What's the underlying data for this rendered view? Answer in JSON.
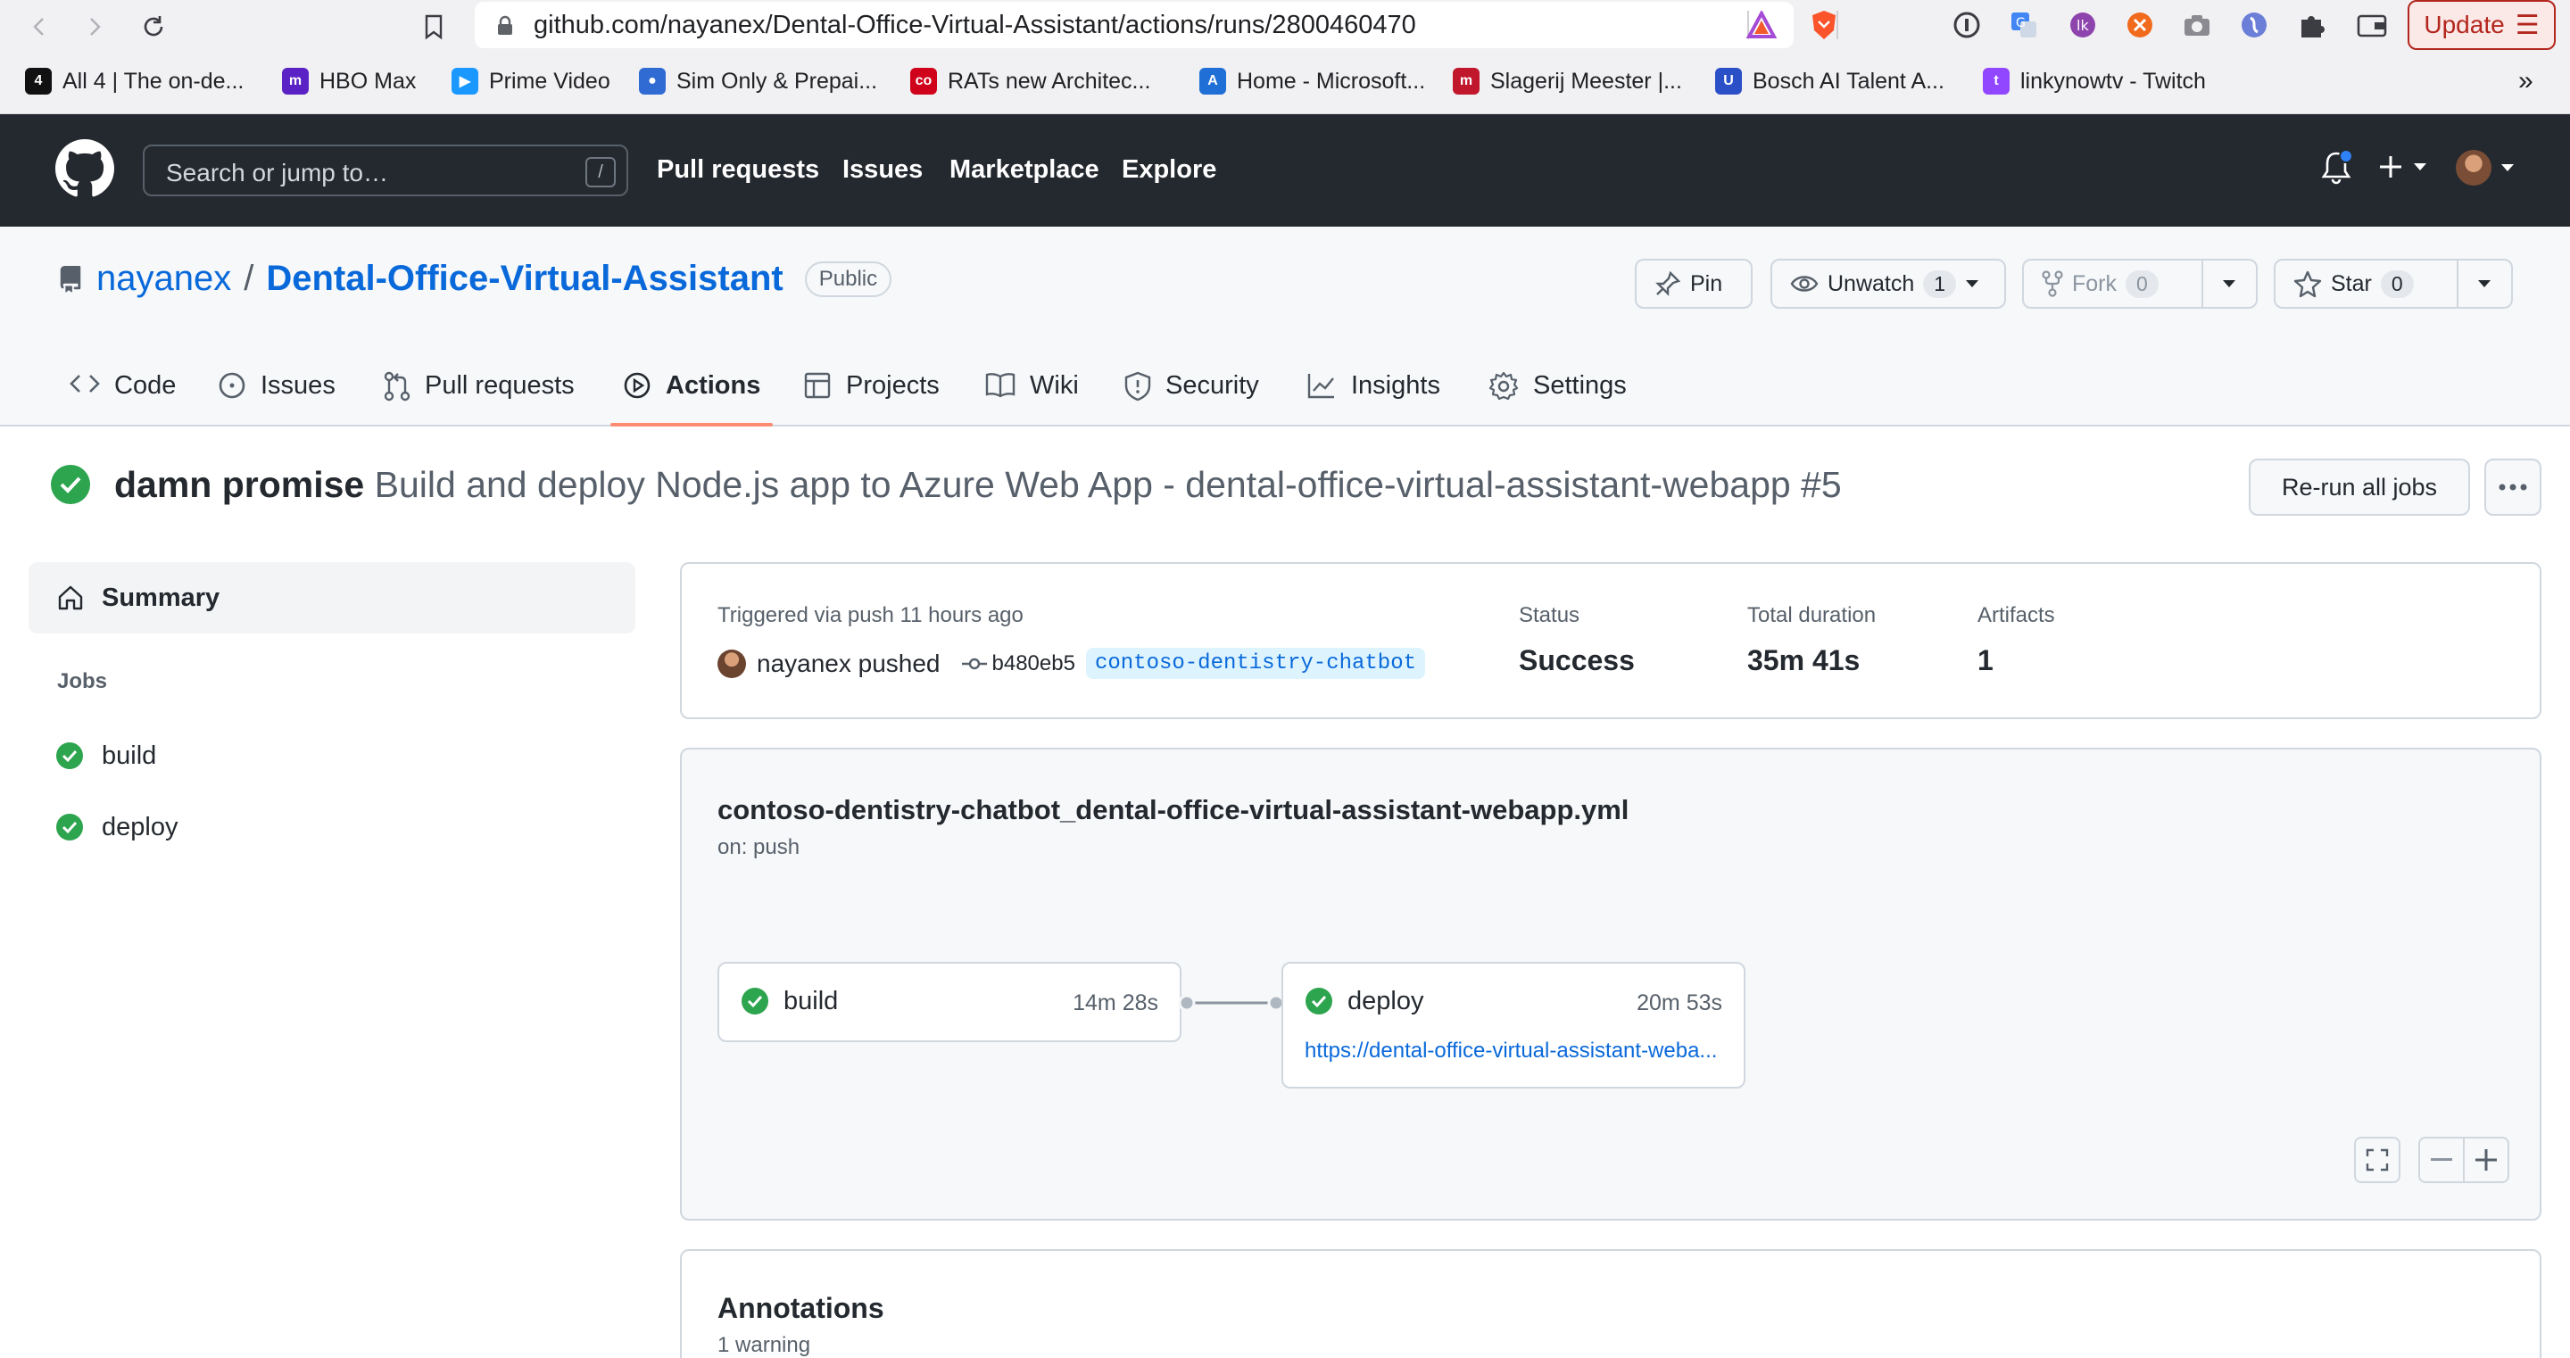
{
  "browser": {
    "url": "github.com/nayanex/Dental-Office-Virtual-Assistant/actions/runs/2800460470",
    "update_label": "Update",
    "bookmarks": [
      {
        "label": "All 4 | The on-de...",
        "color": "#111111",
        "glyph": "4"
      },
      {
        "label": "HBO Max",
        "color": "#5a22c4",
        "glyph": "m"
      },
      {
        "label": "Prime Video",
        "color": "#1a98ff",
        "glyph": "▶"
      },
      {
        "label": "Sim Only & Prepai...",
        "color": "#2f6bd3",
        "glyph": "●"
      },
      {
        "label": "RATs new Architec...",
        "color": "#d0021b",
        "glyph": "co"
      },
      {
        "label": "Home - Microsoft...",
        "color": "#1f6fd6",
        "glyph": "A"
      },
      {
        "label": "Slagerij Meester |...",
        "color": "#c1172c",
        "glyph": "m"
      },
      {
        "label": "Bosch AI Talent A...",
        "color": "#2b4fc7",
        "glyph": "U"
      },
      {
        "label": "linkynowtv - Twitch",
        "color": "#9146ff",
        "glyph": "t"
      }
    ],
    "more_bookmarks": "»"
  },
  "header": {
    "search_placeholder": "Search or jump to…",
    "search_key": "/",
    "nav": [
      "Pull requests",
      "Issues",
      "Marketplace",
      "Explore"
    ]
  },
  "repo": {
    "owner": "nayanex",
    "separator": "/",
    "name": "Dental-Office-Virtual-Assistant",
    "visibility": "Public",
    "pin_label": "Pin",
    "unwatch_label": "Unwatch",
    "unwatch_count": "1",
    "fork_label": "Fork",
    "fork_count": "0",
    "star_label": "Star",
    "star_count": "0",
    "tabs": [
      "Code",
      "Issues",
      "Pull requests",
      "Actions",
      "Projects",
      "Wiki",
      "Security",
      "Insights",
      "Settings"
    ],
    "active_tab": "Actions"
  },
  "run": {
    "commit_message": "damn promise",
    "workflow_title": "Build and deploy Node.js app to Azure Web App - dental-office-virtual-assistant-webapp #5",
    "rerun_label": "Re-run all jobs"
  },
  "sidebar": {
    "summary_label": "Summary",
    "jobs_label": "Jobs",
    "jobs": [
      "build",
      "deploy"
    ]
  },
  "summary": {
    "triggered_text": "Triggered via push 11 hours ago",
    "actor_text": "nayanex pushed",
    "commit_sha": "b480eb5",
    "branch": "contoso-dentistry-chatbot",
    "status_label": "Status",
    "status_value": "Success",
    "duration_label": "Total duration",
    "duration_value": "35m 41s",
    "artifacts_label": "Artifacts",
    "artifacts_value": "1"
  },
  "workflow_graph": {
    "file": "contoso-dentistry-chatbot_dental-office-virtual-assistant-webapp.yml",
    "trigger": "on: push",
    "jobs": [
      {
        "name": "build",
        "duration": "14m 28s"
      },
      {
        "name": "deploy",
        "duration": "20m 53s",
        "link": "https://dental-office-virtual-assistant-weba..."
      }
    ]
  },
  "annotations": {
    "title": "Annotations",
    "subtitle": "1 warning"
  },
  "colors": {
    "success": "#2da44e",
    "link": "#0969da",
    "header_bg": "#24292f",
    "active_tab_underline": "#fd8c73"
  }
}
